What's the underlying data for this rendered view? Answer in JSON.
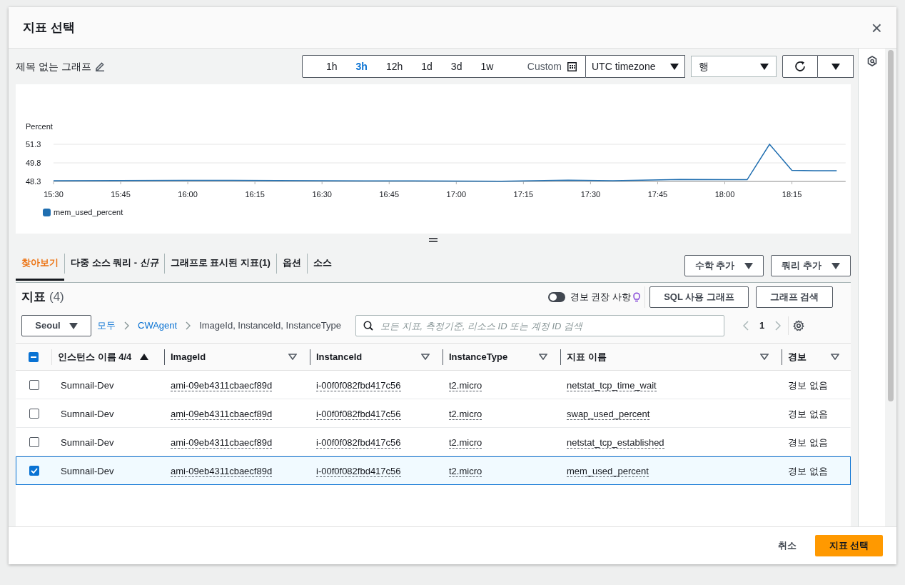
{
  "dialog": {
    "title": "지표 선택",
    "close": "×"
  },
  "graph": {
    "title": "제목 없는 그래프",
    "ranges": [
      {
        "label": "1h",
        "selected": false
      },
      {
        "label": "3h",
        "selected": true
      },
      {
        "label": "12h",
        "selected": false
      },
      {
        "label": "1d",
        "selected": false
      },
      {
        "label": "3d",
        "selected": false
      },
      {
        "label": "1w",
        "selected": false
      }
    ],
    "custom": "Custom",
    "timezone": "UTC timezone",
    "view": "행",
    "chart_data": {
      "type": "line",
      "ylabel": "Percent",
      "x": [
        15.5,
        16.1667,
        16.5,
        16.8333,
        17.1667,
        17.4167,
        17.5833,
        17.8333,
        18.0833,
        18.1667,
        18.25,
        18.3333,
        18.4167
      ],
      "series": [
        {
          "name": "mem_used_percent",
          "color": "#1f6eb0",
          "values": [
            48.36,
            48.39,
            48.35,
            48.34,
            48.31,
            48.4,
            48.35,
            48.46,
            48.44,
            51.3,
            49.2,
            49.16,
            49.16
          ]
        }
      ],
      "xlim": [
        15.5,
        18.45
      ],
      "ylim": [
        48.3,
        51.3
      ],
      "xticks": [
        {
          "value": 15.5,
          "label": "15:30"
        },
        {
          "value": 15.75,
          "label": "15:45"
        },
        {
          "value": 16,
          "label": "16:00"
        },
        {
          "value": 16.25,
          "label": "16:15"
        },
        {
          "value": 16.5,
          "label": "16:30"
        },
        {
          "value": 16.75,
          "label": "16:45"
        },
        {
          "value": 17,
          "label": "17:00"
        },
        {
          "value": 17.25,
          "label": "17:15"
        },
        {
          "value": 17.5,
          "label": "17:30"
        },
        {
          "value": 17.75,
          "label": "17:45"
        },
        {
          "value": 18,
          "label": "18:00"
        },
        {
          "value": 18.25,
          "label": "18:15"
        }
      ],
      "yticks": [
        48.3,
        49.8,
        51.3
      ]
    }
  },
  "tabs": [
    {
      "label": "찾아보기",
      "selected": true
    },
    {
      "label": "다중 소스 쿼리 - *신규*",
      "selected": false
    },
    {
      "label": "그래프로 표시된 지표(1)",
      "selected": false
    },
    {
      "label": "옵션",
      "selected": false
    },
    {
      "label": "소스",
      "selected": false
    }
  ],
  "tab_actions": [
    "수학 추가",
    "쿼리 추가"
  ],
  "metrics": {
    "title": "지표",
    "count": "(4)",
    "alarm_toggle": {
      "label": "경보 권장 사항",
      "on": false
    },
    "buttons": [
      "SQL 사용 그래프",
      "그래프 검색"
    ],
    "region": "Seoul",
    "breadcrumb": [
      {
        "label": "모두",
        "kind": "link"
      },
      {
        "label": "CWAgent",
        "kind": "link"
      },
      {
        "label": "ImageId, InstanceId, InstanceType",
        "kind": "text"
      }
    ],
    "search": {
      "placeholder": "모든 지표, 측정기준, 리소스 ID 또는 계정 ID 검색"
    },
    "page": "1",
    "table": {
      "partially_checked": true,
      "columns": [
        {
          "label": "인스턴스 이름 4/4",
          "sorted": true
        },
        {
          "label": "ImageId",
          "sorted": false
        },
        {
          "label": "InstanceId",
          "sorted": false
        },
        {
          "label": "InstanceType",
          "sorted": false
        },
        {
          "label": "지표 이름",
          "sorted": false
        },
        {
          "label": "경보",
          "sorted": false
        }
      ],
      "rows": [
        {
          "selected": false,
          "cells": [
            "Sumnail-Dev",
            "ami-09eb4311cbaecf89d",
            "i-00f0f082fbd417c56",
            "t2.micro",
            "netstat_tcp_time_wait",
            "경보 없음"
          ]
        },
        {
          "selected": false,
          "cells": [
            "Sumnail-Dev",
            "ami-09eb4311cbaecf89d",
            "i-00f0f082fbd417c56",
            "t2.micro",
            "swap_used_percent",
            "경보 없음"
          ]
        },
        {
          "selected": false,
          "cells": [
            "Sumnail-Dev",
            "ami-09eb4311cbaecf89d",
            "i-00f0f082fbd417c56",
            "t2.micro",
            "netstat_tcp_established",
            "경보 없음"
          ]
        },
        {
          "selected": true,
          "cells": [
            "Sumnail-Dev",
            "ami-09eb4311cbaecf89d",
            "i-00f0f082fbd417c56",
            "t2.micro",
            "mem_used_percent",
            "경보 없음"
          ]
        }
      ]
    }
  },
  "footer": {
    "cancel": "취소",
    "confirm": "지표 선택"
  }
}
